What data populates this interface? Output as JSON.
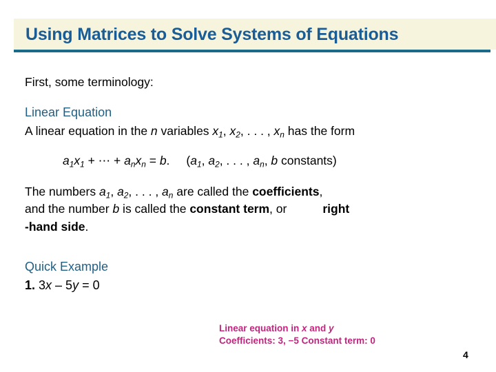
{
  "slide": {
    "title": "Using Matrices to Solve Systems of Equations",
    "page_number": "4",
    "colors": {
      "title_text": "#1a5d96",
      "title_band": "#f7f4dd",
      "title_rule": "#1a6b8a",
      "section_heading": "#1f5f86",
      "annotation": "#c2247e",
      "body_text": "#000000",
      "background": "#ffffff"
    }
  },
  "body": {
    "intro": "First, some terminology:",
    "definition": {
      "heading": "Linear Equation",
      "text_part1": "A linear equation in the ",
      "var_n": "n",
      "text_part2": " variables ",
      "x": "x",
      "sub1": "1",
      "comma1": ", ",
      "sub2": "2",
      "ellipsis": ", . . . , ",
      "subn": "n",
      "text_part3": " has the form",
      "formula": {
        "a": "a",
        "x": "x",
        "sub1": "1",
        "subn": "n",
        "plus_dots": " + ⋯ + ",
        "equals": " = ",
        "b": "b",
        "period": ".",
        "paren_open": "(",
        "sub2": "2",
        "constants": " constants)",
        "comma": ", "
      }
    },
    "numbers_para": {
      "lead": "The numbers ",
      "a": "a",
      "sub1": "1",
      "sub2": "2",
      "subn": "n",
      "ellipsis": ", . . . , ",
      "called": " are called the ",
      "coefficients": "coefficients",
      "comma": ",",
      "and_number": "and the number ",
      "b": "b",
      "is_called": " is called the ",
      "constant_term": "constant term",
      "or": ", or",
      "right": "right",
      "hand_side": "-hand side",
      "final_period": "."
    },
    "quick_example": {
      "heading": "Quick Example",
      "number": "1.",
      "equation_pre": " 3",
      "x": "x",
      "minus": " – 5",
      "y": "y",
      "equals": " = 0"
    }
  },
  "annotation": {
    "line1_pre": "Linear equation in ",
    "line1_x": "x",
    "line1_mid": " and ",
    "line1_y": "y",
    "line2": "Coefficients: 3, −5 Constant term: 0"
  }
}
